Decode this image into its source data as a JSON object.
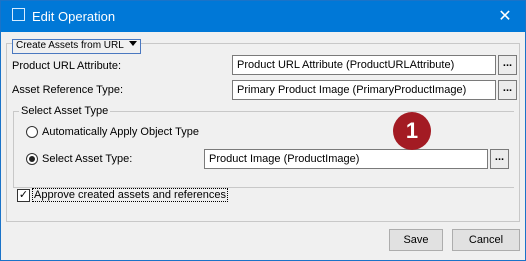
{
  "window": {
    "title": "Edit Operation",
    "app_icon": "window-icon",
    "close_glyph": "✕",
    "accent": "#0078d7"
  },
  "dropdown": {
    "selected": "Create Assets from URL",
    "icon": "chevron-down-icon"
  },
  "fields": {
    "product_url": {
      "label": "Product URL Attribute:",
      "value": "Product URL Attribute (ProductURLAttribute)",
      "button": "..."
    },
    "asset_ref": {
      "label": "Asset Reference Type:",
      "value": "Primary Product Image (PrimaryProductImage)",
      "button": "..."
    }
  },
  "asset_type_group": {
    "title": "Select Asset Type",
    "option_auto": {
      "label": "Automatically Apply Object Type",
      "checked": false
    },
    "option_select": {
      "label": "Select Asset Type:",
      "checked": true,
      "value": "Product Image (ProductImage)",
      "button": "..."
    }
  },
  "approve": {
    "label": "Approve created assets and references",
    "checked": true
  },
  "badge": {
    "text": "1",
    "color": "#a31b23"
  },
  "buttons": {
    "save": "Save",
    "cancel": "Cancel"
  }
}
